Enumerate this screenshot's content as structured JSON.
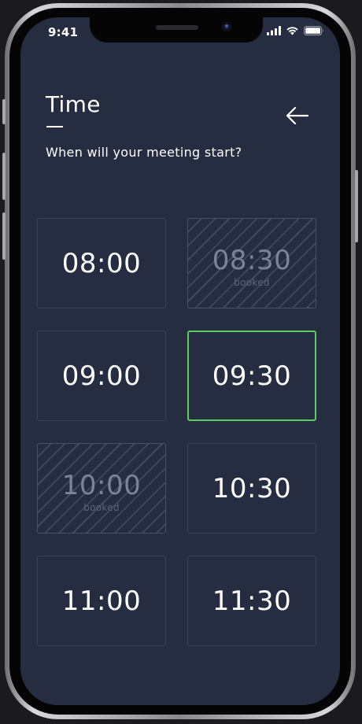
{
  "status_bar": {
    "time": "9:41"
  },
  "header": {
    "title": "Time",
    "subtitle": "When will your meeting start?",
    "back_icon": "arrow-left-icon"
  },
  "slots": [
    {
      "time": "08:00",
      "state": "available",
      "note": ""
    },
    {
      "time": "08:30",
      "state": "booked",
      "note": "booked"
    },
    {
      "time": "09:00",
      "state": "available",
      "note": ""
    },
    {
      "time": "09:30",
      "state": "selected",
      "note": ""
    },
    {
      "time": "10:00",
      "state": "booked",
      "note": "booked"
    },
    {
      "time": "10:30",
      "state": "available",
      "note": ""
    },
    {
      "time": "11:00",
      "state": "available",
      "note": ""
    },
    {
      "time": "11:30",
      "state": "available",
      "note": ""
    }
  ],
  "colors": {
    "background": "#262d40",
    "selected_border": "#5ccb5f",
    "slot_border": "#3a4154",
    "booked_text": "#7d8395"
  }
}
